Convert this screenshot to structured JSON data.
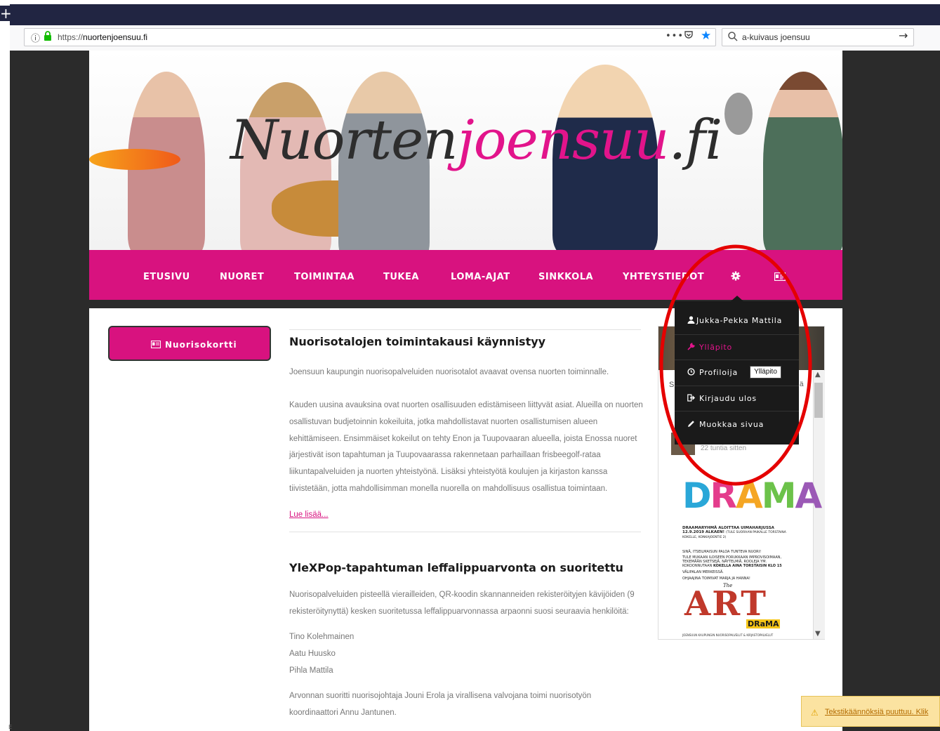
{
  "browser": {
    "new_tab": "+",
    "url_scheme": "https://",
    "url_host": "nuortenjoensuu.fi",
    "page_actions": "•••",
    "search_text": "a-kuivaus joensuu",
    "search_go": "→"
  },
  "header": {
    "logo_part1": "Nuorten",
    "logo_part2": "joensuu",
    "logo_part3": ".fi"
  },
  "nav": {
    "items": [
      "ETUSIVU",
      "NUORET",
      "TOIMINTAA",
      "TUKEA",
      "LOMA-AJAT",
      "SINKKOLA",
      "YHTEYSTIEDOT"
    ]
  },
  "sidebar": {
    "card_button": "Nuorisokortti"
  },
  "dropdown": {
    "items": [
      "Jukka-Pekka Mattila",
      "Ylläpito",
      "Profiloija",
      "Kirjaudu ulos",
      "Muokkaa sivua"
    ],
    "tooltip": "Ylläpito"
  },
  "posts": [
    {
      "title": "Nuorisotalojen toimintakausi käynnistyy",
      "intro": "Joensuun kaupungin nuorisopalveluiden nuorisotalot avaavat ovensa nuorten toiminnalle.",
      "body": "Kauden uusina avauksina ovat nuorten osallisuuden edistämiseen liittyvät asiat. Alueilla on nuorten osallistuvan budjetoinnin kokeiluita, jotka mahdollistavat nuorten osallistumisen alueen kehittämiseen. Ensimmäiset kokeilut on tehty Enon ja Tuupovaaran alueella, joista Enossa nuoret järjestivät ison tapahtuman ja Tuupovaarassa rakennetaan parhaillaan frisbeegolf-rataa liikuntapalveluiden ja nuorten yhteistyönä. Lisäksi yhteistyötä koulujen ja kirjaston kanssa tiivistetään, jotta mahdollisimman monella nuorella on mahdollisuus osallistua toimintaan.",
      "read_more": "Lue lisää..."
    },
    {
      "title": "YleXPop-tapahtuman leffalippuarvonta on suoritettu",
      "intro": "Nuorisopalveluiden pisteellä vierailleiden, QR-koodin skannanneiden rekisteröityjen kävijöiden (9 rekisteröitynyttä) kesken suoritetussa leffalippuarvonnassa arpaonni suosi seuraavia henkilöitä:",
      "winners": [
        "Tino Kolehmainen",
        "Aatu Huusko",
        "Pihla Mattila"
      ],
      "outro": "Arvonnan suoritti nuorisojohtaja Jouni Erola ja virallisena valvojana toimi nuorisotyön koordinaattori Annu Jantunen."
    }
  ],
  "widget": {
    "letter_left": "S",
    "letter_right": "ä",
    "time_ago": "22 tuntia sitten",
    "poster_title": "DRAMA",
    "poster_head": "DRAAMARYHMÄ ALOITTAA UIMAHARJUSSA 12.9.2019 ALKAEN!",
    "poster_head_small": "(TULE SUORAAN PAIKALLE TORSTAINA KOKELLE, KONKAJOENTIE 2)",
    "poster_body1": "SINÄ, ITSEILMAISUN PALOA TUNTEVA NUORI!",
    "poster_body2": "TULE MUKAAN ILOISEEN PORUKKAAN IMPROVISOIMAAN, TEKEMÄÄN SKETSEJÄ, NÄYTELMIÄ, ROOLEJA YM. KOKOONNUTAAN",
    "poster_body2b": "KOKELLA AINA TORSTAISIN KLO 15",
    "poster_body3": "VÄLIPALAN MERKEISSÄ.",
    "poster_body4": "OHJAAJINA TOIMIVAT MARJA JA HANNA!",
    "poster_art_small": "The",
    "poster_art": "ART",
    "poster_drama": "DRaMA",
    "poster_foot": "JOENSUUN KAUPUNGIN NUORISOPALVELUT & KIRJASTOPALVELUT"
  },
  "notice": {
    "icon": "⚠",
    "text": "Tekstikäännöksiä puuttuu. Klik"
  },
  "misc": {
    "corner": "E"
  },
  "colors": {
    "brand_magenta": "#d8127f",
    "browser_dark": "#212542",
    "annotation_red": "#e50000"
  }
}
